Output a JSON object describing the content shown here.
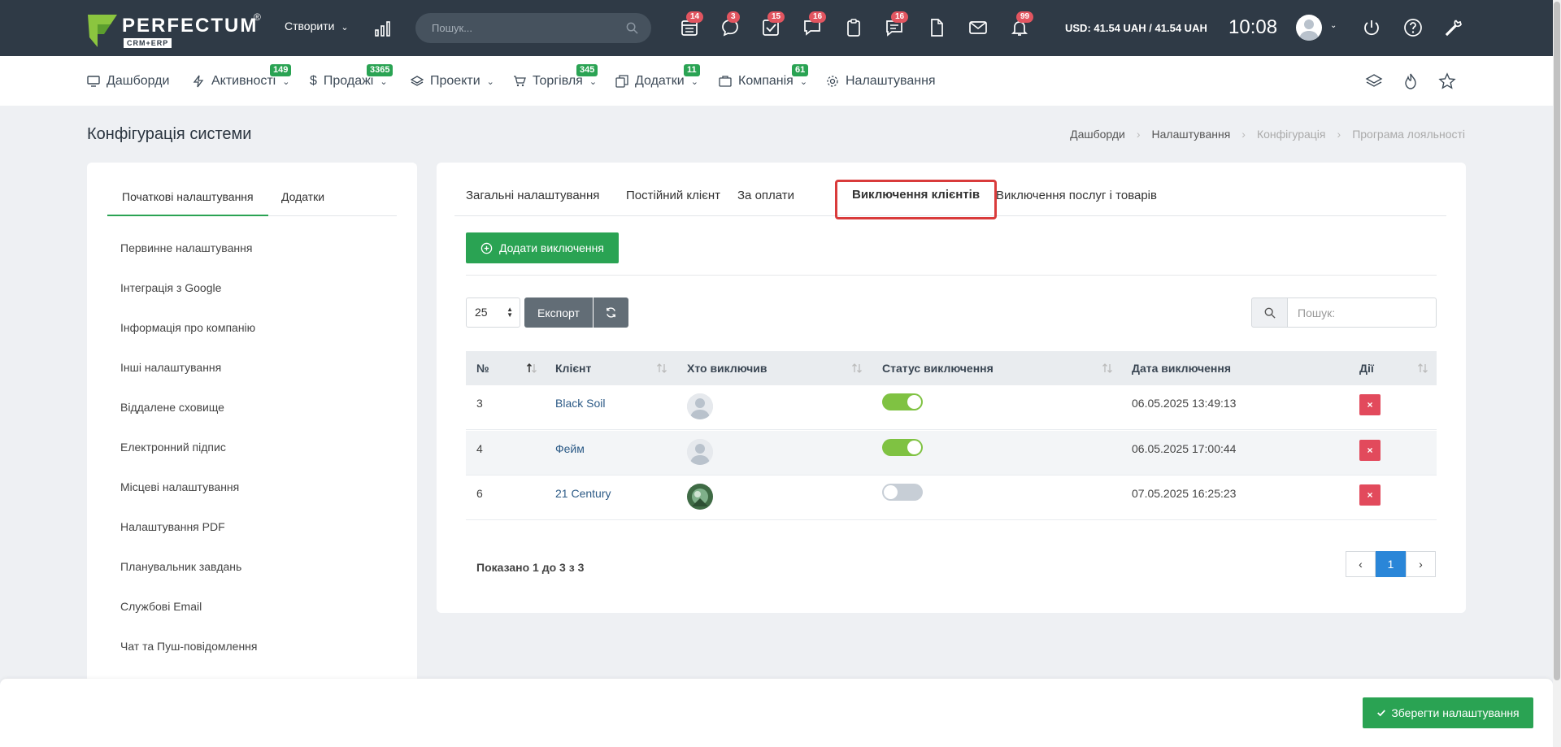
{
  "topbar": {
    "logo_text": "PERFECTUM",
    "logo_reg": "®",
    "logo_sub": "CRM+ERP",
    "create_label": "Створити",
    "search_placeholder": "Пошук...",
    "badges": [
      "14",
      "3",
      "15",
      "16",
      "16",
      "99"
    ],
    "currency": "USD: 41.54 UAH / 41.54 UAH",
    "time": "10:08",
    "caret": "⌄"
  },
  "nav": {
    "items": [
      {
        "label": "Дашборди"
      },
      {
        "label": "Активності",
        "badge": "149"
      },
      {
        "label": "Продажі",
        "badge": "3365"
      },
      {
        "label": "Проекти"
      },
      {
        "label": "Торгівля",
        "badge": "345"
      },
      {
        "label": "Додатки",
        "badge": "11"
      },
      {
        "label": "Компанія",
        "badge": "61"
      },
      {
        "label": "Налаштування"
      }
    ]
  },
  "page": {
    "title": "Конфігурація системи",
    "breadcrumb": [
      "Дашборди",
      "Налаштування",
      "Конфігурація",
      "Програма лояльності"
    ],
    "breadcrumb_sep": "›"
  },
  "left": {
    "tabs": [
      "Початкові налаштування",
      "Додатки"
    ],
    "items": [
      "Первинне налаштування",
      "Інтеграція з Google",
      "Інформація про компанію",
      "Інші налаштування",
      "Віддалене сховище",
      "Електронний підпис",
      "Місцеві налаштування",
      "Налаштування PDF",
      "Планувальник завдань",
      "Службові Email",
      "Чат та Пуш-повідомлення"
    ]
  },
  "main": {
    "tabs": [
      "Загальні налаштування",
      "Постійний клієнт",
      "За оплати",
      "Виключення клієнтів",
      "Виключення послуг і товарів"
    ],
    "add_button": "Додати виключення",
    "page_size": "25",
    "export_label": "Експорт",
    "search_placeholder": "Пошук:",
    "columns": [
      "№",
      "Клієнт",
      "Хто виключив",
      "Статус виключення",
      "Дата виключення",
      "Дії"
    ],
    "rows": [
      {
        "num": "3",
        "client": "Black Soil",
        "status_on": true,
        "date": "06.05.2025 13:49:13"
      },
      {
        "num": "4",
        "client": "Фейм",
        "status_on": true,
        "date": "06.05.2025 17:00:44"
      },
      {
        "num": "6",
        "client": "21 Century",
        "status_on": false,
        "date": "07.05.2025 16:25:23"
      }
    ],
    "delete_label": "×",
    "showing": "Показано 1 до 3 з 3",
    "page_current": "1",
    "pg_prev": "‹",
    "pg_next": "›"
  },
  "footer": {
    "save_label": "Зберегти налаштування"
  },
  "colors": {
    "topbar": "#2f3a46",
    "accent_green": "#2aa353",
    "danger": "#e24a5c",
    "active_tab_outline": "#d93b3b",
    "pager_active": "#2a86d8"
  }
}
